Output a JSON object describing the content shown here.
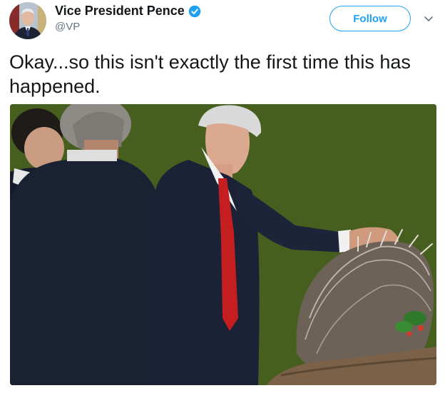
{
  "author": {
    "name": "Vice President Pence",
    "handle": "@VP",
    "verified": true
  },
  "follow_button": {
    "label": "Follow"
  },
  "menu": {
    "icon": "chevron-down-icon"
  },
  "tweet": {
    "text": "Okay...so this isn't exactly the first time this has happened."
  },
  "media": {
    "type": "photo",
    "background_color": "#4a6320"
  },
  "colors": {
    "accent": "#1da1f2",
    "text": "#14171a",
    "muted": "#657786"
  }
}
